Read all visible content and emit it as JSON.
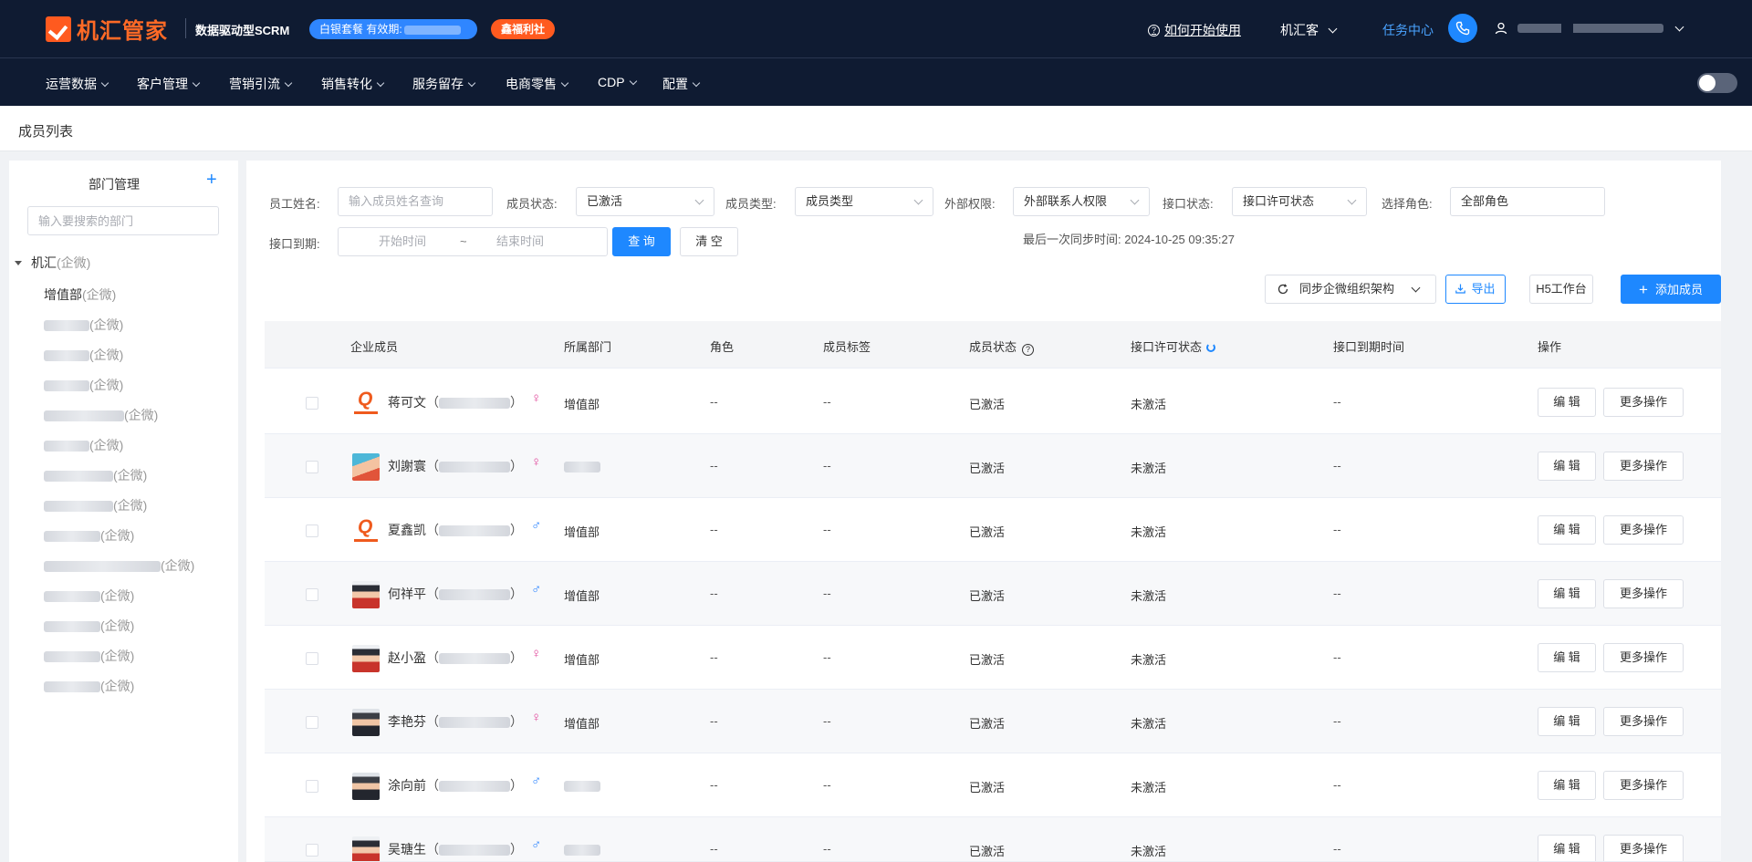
{
  "topbar": {
    "logo_text": "机汇管家",
    "slogan": "数据驱动型SCRM",
    "plan_label": "白银套餐 有效期:",
    "welfare_label": "鑫福利社",
    "how_to_use": "如何开始使用",
    "company": "机汇客",
    "task_center": "任务中心"
  },
  "nav": {
    "items": [
      "运营数据",
      "客户管理",
      "营销引流",
      "销售转化",
      "服务留存",
      "电商零售",
      "CDP",
      "配置"
    ]
  },
  "page": {
    "title": "成员列表"
  },
  "dept": {
    "title": "部门管理",
    "search_placeholder": "输入要搜索的部门",
    "root_label": "机汇",
    "tag": "(企微)",
    "first_child": "增值部"
  },
  "filters": {
    "name_label": "员工姓名:",
    "name_placeholder": "输入成员姓名查询",
    "status_label": "成员状态:",
    "status_value": "已激活",
    "type_label": "成员类型:",
    "type_value": "成员类型",
    "external_label": "外部权限:",
    "external_value": "外部联系人权限",
    "api_status_label": "接口状态:",
    "api_status_value": "接口许可状态",
    "role_label": "选择角色:",
    "role_value": "全部角色",
    "expire_label": "接口到期:",
    "start_placeholder": "开始时间",
    "range_sep": "~",
    "end_placeholder": "结束时间",
    "query_btn": "查 询",
    "clear_btn": "清 空"
  },
  "toolbar": {
    "sync_time_label": "最后一次同步时间:",
    "sync_time": "2024-10-25 09:35:27",
    "sync_btn": "同步企微组织架构",
    "export_btn": "导出",
    "h5_btn": "H5工作台",
    "add_btn": "添加成员"
  },
  "table": {
    "headers": [
      "企业成员",
      "所属部门",
      "角色",
      "成员标签",
      "成员状态",
      "接口许可状态",
      "接口到期时间",
      "操作"
    ],
    "rows": [
      {
        "name": "蒋可文",
        "gender": "♀",
        "dept": "增值部",
        "role": "--",
        "tags": "--",
        "status": "已激活",
        "api": "未激活",
        "expire": "--",
        "edit": "编 辑",
        "more": "更多操作"
      },
      {
        "name": "刘謝寰",
        "gender": "♀",
        "dept": "",
        "role": "--",
        "tags": "--",
        "status": "已激活",
        "api": "未激活",
        "expire": "--",
        "edit": "编 辑",
        "more": "更多操作"
      },
      {
        "name": "夏鑫凯",
        "gender": "♂",
        "dept": "增值部",
        "role": "--",
        "tags": "--",
        "status": "已激活",
        "api": "未激活",
        "expire": "--",
        "edit": "编 辑",
        "more": "更多操作"
      },
      {
        "name": "何祥平",
        "gender": "♂",
        "dept": "增值部",
        "role": "--",
        "tags": "--",
        "status": "已激活",
        "api": "未激活",
        "expire": "--",
        "edit": "编 辑",
        "more": "更多操作"
      },
      {
        "name": "赵小盈",
        "gender": "♀",
        "dept": "增值部",
        "role": "--",
        "tags": "--",
        "status": "已激活",
        "api": "未激活",
        "expire": "--",
        "edit": "编 辑",
        "more": "更多操作"
      },
      {
        "name": "李艳芬",
        "gender": "♀",
        "dept": "增值部",
        "role": "--",
        "tags": "--",
        "status": "已激活",
        "api": "未激活",
        "expire": "--",
        "edit": "编 辑",
        "more": "更多操作"
      },
      {
        "name": "涂向前",
        "gender": "♂",
        "dept": "",
        "role": "--",
        "tags": "--",
        "status": "已激活",
        "api": "未激活",
        "expire": "--",
        "edit": "编 辑",
        "more": "更多操作"
      },
      {
        "name": "吴瑭生",
        "gender": "♂",
        "dept": "",
        "role": "--",
        "tags": "--",
        "status": "已激活",
        "api": "未激活",
        "expire": "--",
        "edit": "编 辑",
        "more": "更多操作"
      }
    ]
  },
  "colors": {
    "primary": "#1e88ff",
    "header_bg": "#0f1b32",
    "brand_orange": "#ff5a1f"
  }
}
